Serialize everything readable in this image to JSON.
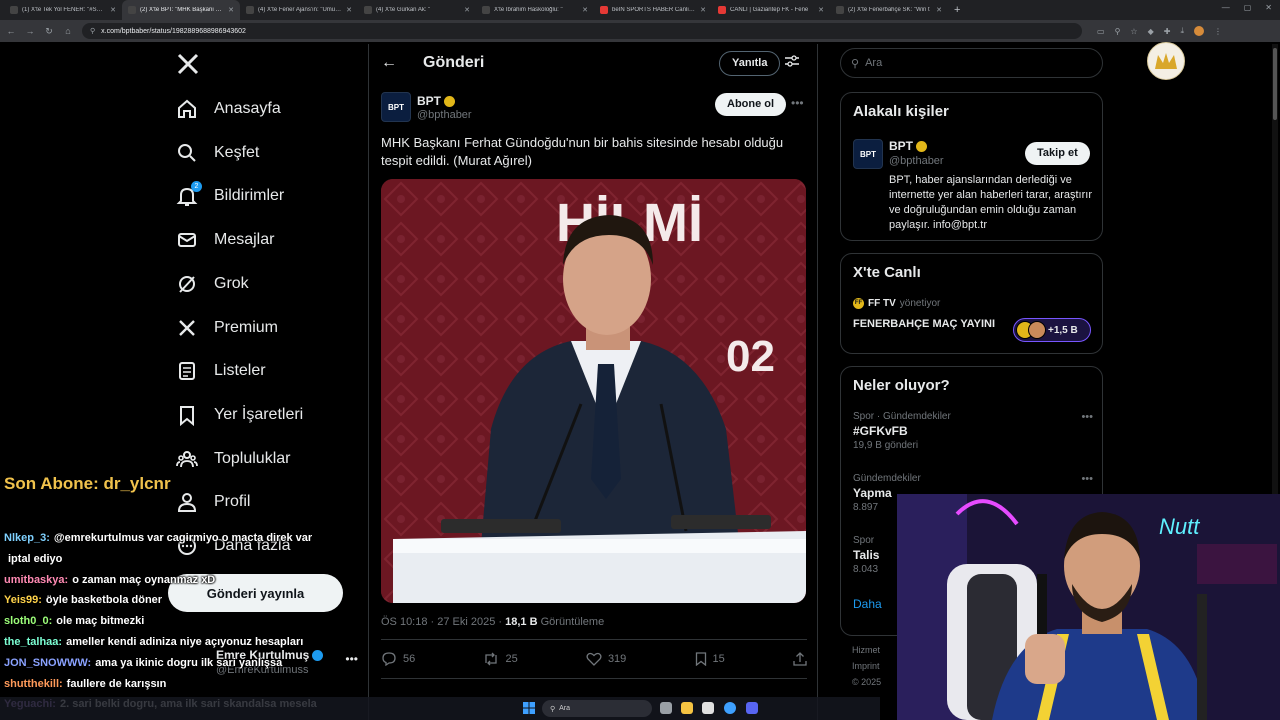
{
  "browser": {
    "tabs": [
      {
        "title": "(1) X'te Tek Yol FENER: \"#SONC",
        "color": "#444"
      },
      {
        "title": "(2) X'te BPT: \"MHK Başkanı Fer",
        "color": "#444",
        "active": true
      },
      {
        "title": "(4) X'te Fener Ajans'ın: \"Umut S",
        "color": "#444"
      },
      {
        "title": "(4) X'te Gürkan Ak: \"",
        "color": "#444"
      },
      {
        "title": "X'te İbrahim Haskoloğlu: \"",
        "color": "#444"
      },
      {
        "title": "beIN SPORTS HABER Canlı Yay",
        "color": "#e53935"
      },
      {
        "title": "CANLI | Gaziantep FK - Fene",
        "color": "#e53935"
      },
      {
        "title": "(2) X'te Fenerbahçe SK: \"Win t",
        "color": "#444"
      }
    ],
    "new_tab": "+",
    "url": "x.com/bptbaber/status/1982889688986943602"
  },
  "nav": {
    "logo": "X",
    "items": [
      {
        "label": "Anasayfa",
        "icon": "home-icon"
      },
      {
        "label": "Keşfet",
        "icon": "search-icon"
      },
      {
        "label": "Bildirimler",
        "icon": "bell-icon",
        "badge": "2"
      },
      {
        "label": "Mesajlar",
        "icon": "mail-icon"
      },
      {
        "label": "Grok",
        "icon": "grok-icon"
      },
      {
        "label": "Premium",
        "icon": "x-premium-icon"
      },
      {
        "label": "Listeler",
        "icon": "list-icon"
      },
      {
        "label": "Yer İşaretleri",
        "icon": "bookmark-icon"
      },
      {
        "label": "Topluluklar",
        "icon": "communities-icon"
      },
      {
        "label": "Profil",
        "icon": "profile-icon"
      },
      {
        "label": "Daha fazla",
        "icon": "more-circle-icon"
      }
    ],
    "post_button": "Gönderi yayınla",
    "account": {
      "name": "Emre Kurtulmuş",
      "handle": "@EmreKurtulmuss"
    }
  },
  "main": {
    "title": "Gönderi",
    "reply_button": "Yanıtla",
    "tweet": {
      "author_name": "BPT",
      "avatar_text": "BPT",
      "author_handle": "@bpthaber",
      "subscribe_button": "Abone ol",
      "text": "MHK Başkanı Ferhat Gündoğdu'nun bir bahis sitesinde hesabı olduğu tespit edildi. (Murat Ağırel)",
      "media_text_1": "HİLMİ",
      "media_text_2": "02",
      "time": "ÖS 10:18 · 27 Eki 2025 · ",
      "views": "18,1 B",
      "views_label": " Görüntüleme",
      "replies": "56",
      "reposts": "25",
      "likes": "319",
      "bookmarks": "15"
    }
  },
  "right": {
    "search_placeholder": "Ara",
    "related": {
      "title": "Alakalı kişiler",
      "name": "BPT",
      "avatar_text": "BPT",
      "handle": "@bpthaber",
      "follow_button": "Takip et",
      "bio": "BPT, haber ajanslarından derlediği ve internette yer alan haberleri tarar, araştırır ve doğruluğundan emin olduğu zaman paylaşır. info@bpt.tr"
    },
    "live": {
      "title": "X'te Canlı",
      "host": "FF TV",
      "host_badge": "FF",
      "host_suffix": "yönetiyor",
      "stream_title": "FENERBAHÇE MAÇ YAYINI",
      "listeners": "+1,5 B"
    },
    "trends": {
      "title": "Neler oluyor?",
      "items": [
        {
          "category": "Spor · Gündemdekiler",
          "name": "#GFKvFB",
          "count": "19,9 B gönderi"
        },
        {
          "category": "Gündemdekiler",
          "name": "Yapma",
          "count": "8.897"
        },
        {
          "category": "Spor",
          "name": "Talis",
          "count": "8.043"
        }
      ],
      "show_more": "Daha",
      "footer": [
        "Hizmet",
        "Imprint",
        "© 2025"
      ]
    }
  },
  "overlay": {
    "last_subscriber": "Son Abone: dr_ylcnr",
    "chat": [
      {
        "user": "Nlkep_3:",
        "color": "#7fd1ff",
        "msg": "@emrekurtulmus var cagirmiyo o macta direk var"
      },
      {
        "user": "",
        "color": "#fff",
        "msg": "iptal ediyo"
      },
      {
        "user": "umitbaskya:",
        "color": "#ff8ab3",
        "msg": "o zaman maç oynanmaz xD"
      },
      {
        "user": "Yeis99:",
        "color": "#ffd34a",
        "msg": "öyle basketbola döner"
      },
      {
        "user": "sloth0_0:",
        "color": "#9dff7a",
        "msg": "ole maç bitmezki"
      },
      {
        "user": "the_talhaa:",
        "color": "#7cffd4",
        "msg": "ameller kendi adiniza niye açıyonuz hesapları"
      },
      {
        "user": "JON_SNOWWW:",
        "color": "#8aa2ff",
        "msg": "ama ya ikinic dogru ilk sari yanlışsa"
      },
      {
        "user": "shutthekill:",
        "color": "#ff9a5a",
        "msg": "faullere de karışsın"
      },
      {
        "user": "Yeguachi:",
        "color": "#c79bff",
        "msg": "2. sari belki dogru, ama ilk sari skandalsa mesela"
      }
    ]
  },
  "taskbar": {
    "search": "Ara"
  }
}
